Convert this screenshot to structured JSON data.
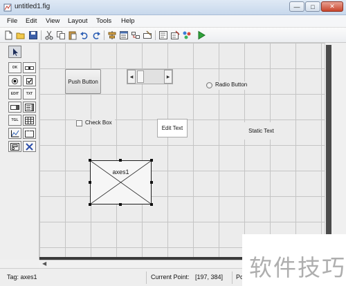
{
  "window": {
    "title": "untitled1.fig",
    "minimize_glyph": "—",
    "maximize_glyph": "□",
    "close_glyph": "✕"
  },
  "menu": {
    "items": [
      "File",
      "Edit",
      "View",
      "Layout",
      "Tools",
      "Help"
    ]
  },
  "toolbar": {
    "icons": [
      "new-file-icon",
      "open-folder-icon",
      "save-icon",
      "cut-icon",
      "copy-icon",
      "paste-icon",
      "undo-icon",
      "redo-icon",
      "align-objects-icon",
      "menu-editor-icon",
      "tab-order-icon",
      "toolbar-editor-icon",
      "editor-icon",
      "property-inspector-icon",
      "object-browser-icon",
      "run-icon"
    ]
  },
  "palette": {
    "tools": [
      {
        "name": "select-tool",
        "icon": "arrow-pointer-icon"
      },
      {
        "name": "push-button-tool",
        "glyph": "OK"
      },
      {
        "name": "slider-tool",
        "icon": "slider-icon"
      },
      {
        "name": "radio-button-tool",
        "icon": "radio-icon"
      },
      {
        "name": "check-box-tool",
        "icon": "checkbox-icon"
      },
      {
        "name": "edit-text-tool",
        "glyph": "EDIT"
      },
      {
        "name": "static-text-tool",
        "glyph": "TXT"
      },
      {
        "name": "popup-menu-tool",
        "icon": "popup-menu-icon"
      },
      {
        "name": "listbox-tool",
        "icon": "listbox-icon"
      },
      {
        "name": "toggle-button-tool",
        "glyph": "TGL"
      },
      {
        "name": "table-tool",
        "icon": "table-icon"
      },
      {
        "name": "axes-tool",
        "icon": "axes-icon"
      },
      {
        "name": "panel-tool",
        "icon": "panel-icon"
      },
      {
        "name": "button-group-tool",
        "icon": "button-group-icon"
      },
      {
        "name": "activex-tool",
        "icon": "activex-icon"
      }
    ]
  },
  "canvas": {
    "push_button_label": "Push Button",
    "radio_button_label": "Radio Button",
    "check_box_label": "Check Box",
    "edit_text_label": "Edit Text",
    "static_text_label": "Static Text",
    "axes_label": "axes1"
  },
  "status": {
    "tag": "Tag: axes1",
    "current_point_label": "Current Point:",
    "current_point_value": "[197, 384]",
    "position_label": "Po"
  },
  "watermark": {
    "text": "软件技巧"
  }
}
